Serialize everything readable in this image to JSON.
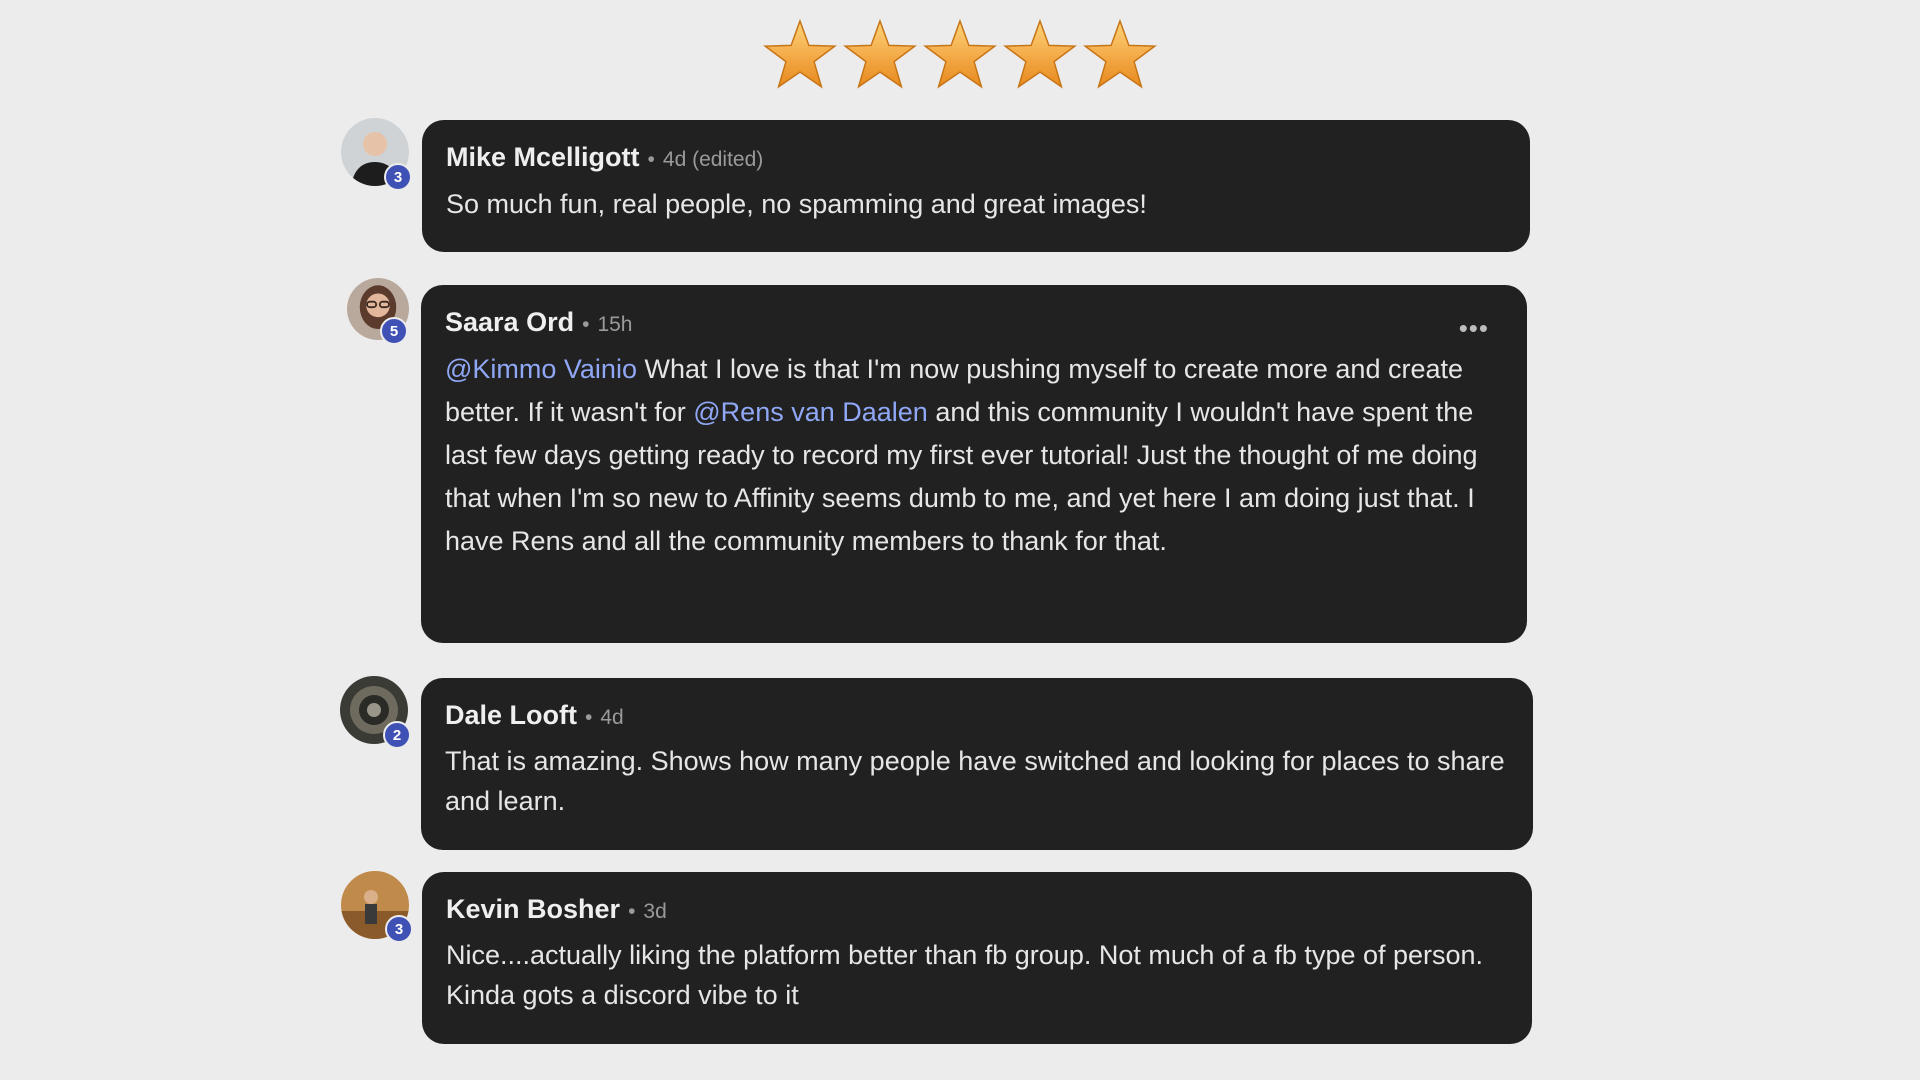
{
  "rating": {
    "stars": 5,
    "max": 5
  },
  "comments": [
    {
      "author": "Mike Mcelligott",
      "meta": "4d (edited)",
      "badge": "3",
      "text": "So much fun, real people, no spamming and great images!"
    },
    {
      "author": "Saara Ord",
      "meta": "15h",
      "badge": "5",
      "more_label": "•••",
      "mention1": "@Kimmo Vainio",
      "text_part1": " What I love is that I'm now pushing myself to create more and create better. If it wasn't for ",
      "mention2": "@Rens van Daalen",
      "text_part2": " and this community I wouldn't have spent the last few days getting ready to record my first ever tutorial! Just the thought of me doing that when I'm so new to Affinity seems dumb to me, and yet here I am doing just that. I have Rens and all the community members to thank for that."
    },
    {
      "author": "Dale Looft",
      "meta": "4d",
      "badge": "2",
      "text": "That is amazing. Shows how many people have switched and looking for places to share and learn."
    },
    {
      "author": "Kevin Bosher",
      "meta": "3d",
      "badge": "3",
      "text": "Nice....actually liking the platform better than fb group. Not much of a fb type of person. Kinda gots a discord vibe to it"
    }
  ],
  "separator": "•",
  "colors": {
    "accent": "#3f51b5",
    "mention": "#8fa7f5",
    "bubble": "#212121",
    "background": "#ececec",
    "star": "#f2a93b"
  }
}
